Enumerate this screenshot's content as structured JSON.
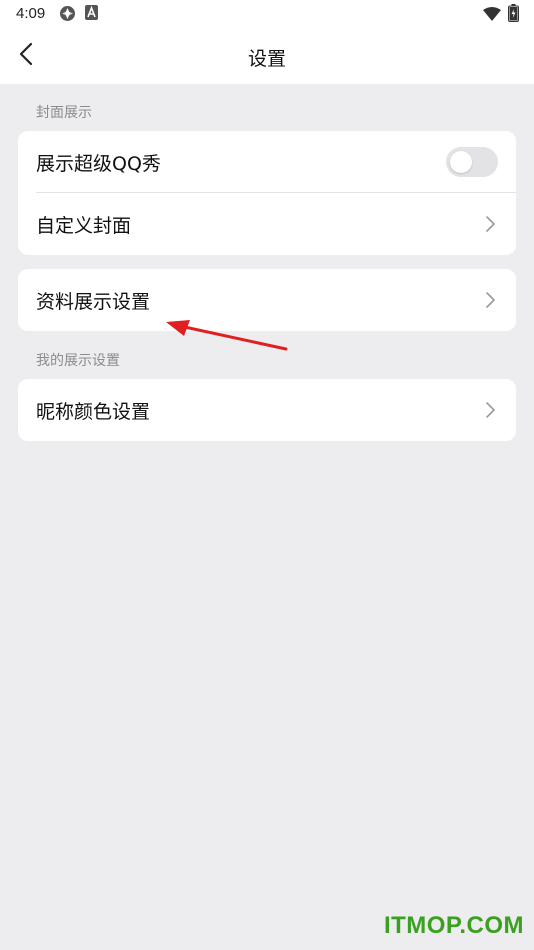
{
  "status_bar": {
    "time": "4:09",
    "icons": [
      "app-badge-icon",
      "a-badge-icon",
      "wifi-icon",
      "battery-charging-icon"
    ]
  },
  "header": {
    "title": "设置",
    "back_icon": "chevron-left-icon"
  },
  "sections": {
    "cover": {
      "label": "封面展示",
      "rows": [
        {
          "label": "展示超级QQ秀",
          "control": "toggle",
          "toggle_on": false
        },
        {
          "label": "自定义封面",
          "control": "chevron"
        }
      ]
    },
    "profile": {
      "rows": [
        {
          "label": "资料展示设置",
          "control": "chevron"
        }
      ]
    },
    "my_display": {
      "label": "我的展示设置",
      "rows": [
        {
          "label": "昵称颜色设置",
          "control": "chevron"
        }
      ]
    }
  },
  "annotation": {
    "arrow_color": "#e02020",
    "points_to": "资料展示设置"
  },
  "watermark": {
    "text": "ITMOP.COM",
    "color": "#3aa01f"
  },
  "colors": {
    "background": "#ededf0",
    "card": "#ffffff",
    "section_label": "#8c8c8c"
  }
}
